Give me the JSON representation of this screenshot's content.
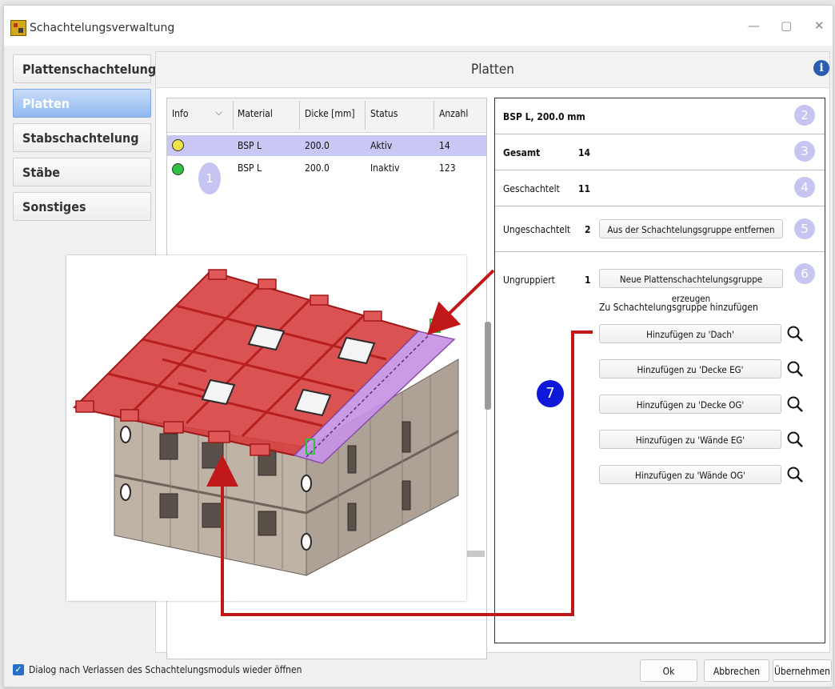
{
  "window": {
    "title": "Schachtelungsverwaltung",
    "minimize": "—",
    "maximize": "▢",
    "close": "✕"
  },
  "sidebar": {
    "items": [
      {
        "label": "Plattenschachtelung",
        "active": false
      },
      {
        "label": "Platten",
        "active": true
      },
      {
        "label": "Stabschachtelung",
        "active": false
      },
      {
        "label": "Stäbe",
        "active": false
      },
      {
        "label": "Sonstiges",
        "active": false
      }
    ]
  },
  "panel": {
    "title": "Platten",
    "info_icon": "info-icon"
  },
  "grid": {
    "headers": [
      "Info",
      "Material",
      "Dicke [mm]",
      "Status",
      "Anzahl"
    ],
    "sort_glyph": "⌵",
    "rows": [
      {
        "dot_color": "#f0e34a",
        "material": "BSP L",
        "dicke": "200.0",
        "status": "Aktiv",
        "anzahl": "14",
        "selected": true
      },
      {
        "dot_color": "#2fc143",
        "material": "BSP L",
        "dicke": "200.0",
        "status": "Inaktiv",
        "anzahl": "123",
        "selected": false
      }
    ]
  },
  "badges": {
    "b1": "1",
    "b2": "2",
    "b3": "3",
    "b4": "4",
    "b5": "5",
    "b6": "6",
    "b7": "7"
  },
  "detail": {
    "heading": "BSP L, 200.0 mm",
    "gesamt_label": "Gesamt",
    "gesamt_value": "14",
    "geschachtelt_label": "Geschachtelt",
    "geschachtelt_value": "11",
    "ungeschachtelt_label": "Ungeschachtelt",
    "ungeschachtelt_value": "2",
    "remove_button": "Aus der Schachtelungsgruppe entfernen",
    "ungruppiert_label": "Ungruppiert",
    "ungruppiert_value": "1",
    "create_button": "Neue Plattenschachtelungsgruppe erzeugen",
    "add_heading": "Zu Schachtelungsgruppe hinzufügen",
    "add_buttons": [
      "Hinzufügen zu 'Dach'",
      "Hinzufügen zu 'Decke EG'",
      "Hinzufügen zu 'Decke OG'",
      "Hinzufügen zu 'Wände EG'",
      "Hinzufügen zu 'Wände OG'"
    ]
  },
  "footer": {
    "checkbox_checked": true,
    "checkbox_label": "Dialog nach Verlassen des Schachtelungsmoduls wieder öffnen",
    "ok": "Ok",
    "cancel": "Abbrechen",
    "apply": "Übernehmen"
  },
  "colors": {
    "accent": "#8fb9ef",
    "selection": "#c9c7f4",
    "badge": "#c6c5f2",
    "badge7": "#0f17d8",
    "arrow": "#c01818",
    "roof": "#d63a3a",
    "highlight": "#c792e6",
    "wall": "#b9ada1"
  }
}
